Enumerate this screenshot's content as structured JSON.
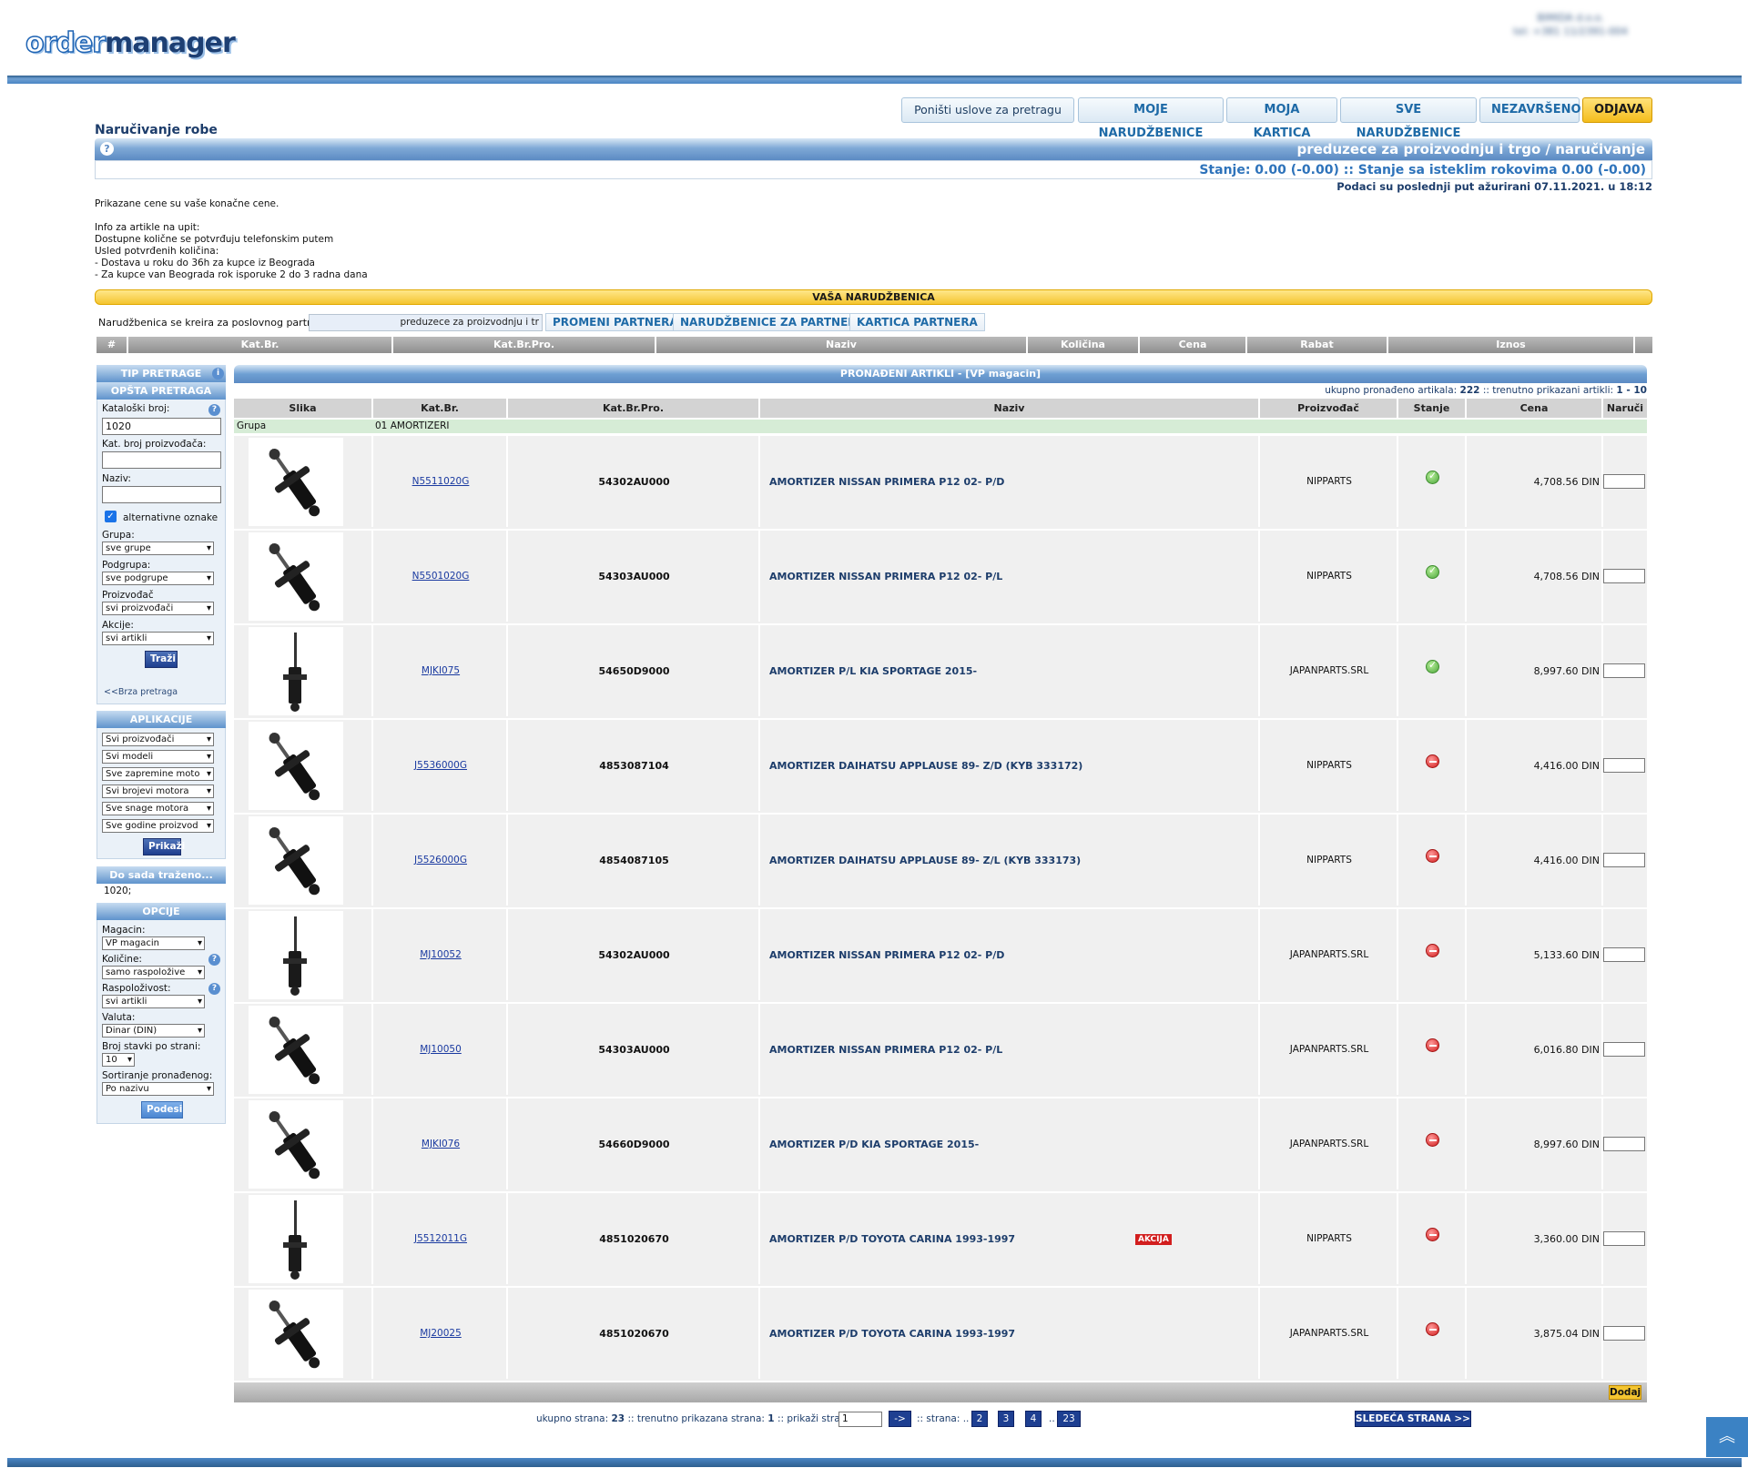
{
  "brand": {
    "part1": "order",
    "part2": "manager"
  },
  "company": {
    "line1": "BIMIDA d.o.o.",
    "line2": "tel: +381 11/2391-004"
  },
  "nav": {
    "reset": "Poništi uslove za pretragu",
    "my_orders": "MOJE NARUDŽBENICE",
    "my_card": "MOJA KARTICA",
    "all_orders": "SVE NARUDŽBENICE",
    "unfinished": "NEZAVRŠENO",
    "logout": "ODJAVA"
  },
  "page": {
    "title": "Naručivanje robe",
    "partner_header": "preduzece za proizvodnju i trgo / naručivanje",
    "balance": "Stanje: 0.00 (-0.00) :: Stanje sa isteklim rokovima 0.00 (-0.00)",
    "updated": "Podaci su poslednji put ažurirani 07.11.2021. u 18:12",
    "info": "Prikazane cene su vaše konačne cene.\n\nInfo za artikle na upit:\nDostupne količne se potvrđuju telefonskim putem\nUsled potvrđenih količina:\n- Dostava u roku do 36h za kupce iz Beograda\n- Za kupce van Beograda rok isporuke 2 do 3 radna dana"
  },
  "order": {
    "bar_title": "VAŠA NARUDŽBENICA",
    "partner_label": "Narudžbenica se kreira za poslovnog partnera:",
    "partner_value": "preduzece za proizvodnju i tr",
    "btn_change": "PROMENI PARTNERA",
    "btn_orders": "NARUDŽBENICE ZA PARTNERA",
    "btn_card": "KARTICA PARTNERA",
    "columns": [
      "#",
      "Kat.Br.",
      "Kat.Br.Pro.",
      "Naziv",
      "Količina",
      "Cena",
      "Rabat",
      "Iznos"
    ]
  },
  "sidebar": {
    "search_type": "TIP PRETRAGE",
    "general": "OPŠTA PRETRAGA",
    "catalog_label": "Kataloški broj:",
    "catalog_value": "1020",
    "mfr_label": "Kat. broj proizvođača:",
    "name_label": "Naziv:",
    "alt_label": "alternativne oznake",
    "group_label": "Grupa:",
    "group_value": "sve grupe",
    "subgroup_label": "Podgrupa:",
    "subgroup_value": "sve podgrupe",
    "producer_label": "Proizvođač",
    "producer_value": "svi proizvođači",
    "actions_label": "Akcije:",
    "actions_value": "svi artikli",
    "search_btn": "Traži",
    "quick": "<<Brza pretraga",
    "apps": "APLIKACIJE",
    "app_selects": [
      "Svi proizvođači",
      "Svi modeli",
      "Sve zapremine moto",
      "Svi brojevi motora",
      "Sve snage motora",
      "Sve godine proizvod"
    ],
    "show_btn": "Prikaži",
    "history_title": "Do sada traženo...",
    "history_value": "1020;",
    "options": "OPCIJE",
    "warehouse_label": "Magacin:",
    "warehouse_value": "VP magacin",
    "qty_label": "Količine:",
    "qty_value": "samo raspoložive",
    "avail_label": "Raspoloživost:",
    "avail_value": "svi artikli",
    "currency_label": "Valuta:",
    "currency_value": "Dinar (DIN)",
    "perpage_label": "Broj stavki po strani:",
    "perpage_value": "10",
    "sort_label": "Sortiranje pronađenog:",
    "sort_value": "Po nazivu",
    "set_btn": "Podesi"
  },
  "results": {
    "title": "PRONAĐENI ARTIKLI - [VP magacin]",
    "counts_prefix": "ukupno pronađeno artikala:",
    "total": "222",
    "counts_mid": ":: trenutno prikazani artikli:",
    "range": "1 - 10",
    "columns": [
      "Slika",
      "Kat.Br.",
      "Kat.Br.Pro.",
      "Naziv",
      "Proizvođač",
      "Stanje",
      "Cena",
      "Naruči"
    ],
    "group_label": "Grupa",
    "group_value": "01 AMORTIZERI",
    "rows": [
      {
        "code": "N5511020G",
        "pro": "54302AU000",
        "name": "AMORTIZER NISSAN PRIMERA P12 02- P/D",
        "producer": "NIPPARTS",
        "status": "ok",
        "price": "4,708.56 DIN",
        "badge": ""
      },
      {
        "code": "N5501020G",
        "pro": "54303AU000",
        "name": "AMORTIZER NISSAN PRIMERA P12 02- P/L",
        "producer": "NIPPARTS",
        "status": "ok",
        "price": "4,708.56 DIN",
        "badge": ""
      },
      {
        "code": "MJKI075",
        "pro": "54650D9000",
        "name": "AMORTIZER P/L KIA SPORTAGE 2015-",
        "producer": "JAPANPARTS.SRL",
        "status": "ok",
        "price": "8,997.60 DIN",
        "badge": ""
      },
      {
        "code": "J5536000G",
        "pro": "4853087104",
        "name": "AMORTIZER DAIHATSU APPLAUSE 89- Z/D (KYB 333172)",
        "producer": "NIPPARTS",
        "status": "no",
        "price": "4,416.00 DIN",
        "badge": ""
      },
      {
        "code": "J5526000G",
        "pro": "4854087105",
        "name": "AMORTIZER DAIHATSU APPLAUSE 89- Z/L (KYB 333173)",
        "producer": "NIPPARTS",
        "status": "no",
        "price": "4,416.00 DIN",
        "badge": ""
      },
      {
        "code": "MJ10052",
        "pro": "54302AU000",
        "name": "AMORTIZER NISSAN PRIMERA P12 02- P/D",
        "producer": "JAPANPARTS.SRL",
        "status": "no",
        "price": "5,133.60 DIN",
        "badge": ""
      },
      {
        "code": "MJ10050",
        "pro": "54303AU000",
        "name": "AMORTIZER NISSAN PRIMERA P12 02- P/L",
        "producer": "JAPANPARTS.SRL",
        "status": "no",
        "price": "6,016.80 DIN",
        "badge": ""
      },
      {
        "code": "MJKI076",
        "pro": "54660D9000",
        "name": "AMORTIZER P/D KIA SPORTAGE 2015-",
        "producer": "JAPANPARTS.SRL",
        "status": "no",
        "price": "8,997.60 DIN",
        "badge": ""
      },
      {
        "code": "J5512011G",
        "pro": "4851020670",
        "name": "AMORTIZER P/D TOYOTA CARINA 1993-1997",
        "producer": "NIPPARTS",
        "status": "no",
        "price": "3,360.00 DIN",
        "badge": "AKCIJA"
      },
      {
        "code": "MJ20025",
        "pro": "4851020670",
        "name": "AMORTIZER P/D TOYOTA CARINA 1993-1997",
        "producer": "JAPANPARTS.SRL",
        "status": "no",
        "price": "3,875.04 DIN",
        "badge": ""
      }
    ],
    "add_btn": "Dodaj"
  },
  "pager": {
    "total_label": "ukupno strana:",
    "total": "23",
    "current_label": ":: trenutno prikazana strana:",
    "current": "1",
    "goto_label": ":: prikaži stranu:",
    "goto_value": "1",
    "go_btn": "->",
    "pages_label": ":: strana: ..",
    "pages": [
      "2",
      "3",
      "4"
    ],
    "dots": "..",
    "last": "23",
    "next": "SLEDEĆA STRANA >>"
  }
}
